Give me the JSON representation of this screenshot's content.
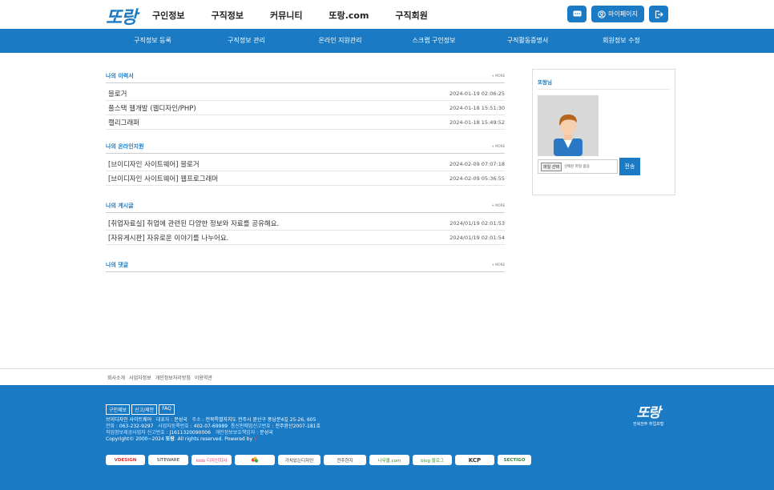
{
  "header": {
    "logo": "또랑",
    "nav": [
      "구인정보",
      "구직정보",
      "커뮤니티",
      "또랑.com",
      "구직회원"
    ],
    "mypage_label": "마이페이지"
  },
  "subnav": [
    "구직정보 등록",
    "구직정보 관리",
    "온라인 지원관리",
    "스크랩 구인정보",
    "구직활동증명서",
    "회원정보 수정"
  ],
  "sections": {
    "resume": {
      "title": "나의 이력서",
      "more": "+ MORE",
      "rows": [
        {
          "title": "블로거",
          "date": "2024-01-19 02:06:25"
        },
        {
          "title": "풀스택 웹개발 (웹디자인/PHP)",
          "date": "2024-01-18 15:51:30"
        },
        {
          "title": "캘리그래퍼",
          "date": "2024-01-18 15:49:52"
        }
      ]
    },
    "apply": {
      "title": "나의 온라인지원",
      "more": "+ MORE",
      "rows": [
        {
          "title": "[브이디자인 사이트웨어] 블로거",
          "date": "2024-02-09 07:07:18"
        },
        {
          "title": "[브이디자인 사이트웨어] 웹프로그래머",
          "date": "2024-02-09 05:36:55"
        }
      ]
    },
    "posts": {
      "title": "나의 게시글",
      "more": "+ MORE",
      "rows": [
        {
          "title": "[취업자료실] 취업에 관련된 다양한 정보와 자료를 공유해요.",
          "date": "2024/01/19 02:01:53"
        },
        {
          "title": "[자유게시판] 자유로운 이야기를 나누어요.",
          "date": "2024/01/19 02:01:54"
        }
      ]
    },
    "comments": {
      "title": "나의 댓글",
      "more": "+ MORE"
    }
  },
  "profile": {
    "name": "또랑님",
    "file_button": "파일 선택",
    "file_status": "선택된 파일 없음",
    "send_label": "전송"
  },
  "footer_links": [
    "회사소개",
    "사업자정보",
    "개인정보처리방침",
    "이용약관"
  ],
  "footer": {
    "buttons": [
      "구인제보",
      "신고/제안",
      "FAQ"
    ],
    "line1_company": "브이디자인 사이트웨어",
    "line1_rep_label": "대표자 : ",
    "line1_rep": "문성국",
    "line1_addr_label": "주소 : ",
    "line1_addr": "전북특별자치도 전주시 완산구 풍남문4길 25-26, 605",
    "line2_tel_label": "전화 : ",
    "line2_tel": "063-232-9297",
    "line2_biz_label": "사업자등록번호 : ",
    "line2_biz": "402-07-69989",
    "line2_mail_label": "통신판매업신고번호 : ",
    "line2_mail": "전주완산2007-181호",
    "line3_job_label": "직업정보제공사업자 신고번호 : ",
    "line3_job": "J1611320090006",
    "line3_priv_label": "개인정보보호책임자 : ",
    "line3_priv": "문성국",
    "line4_pre": "Copyright© 2000~2024 ",
    "line4_brand": "또랑",
    "line4_post": ". All rights reserved. Powered by ",
    "line4_v": "V",
    "logo_big": "또랑",
    "logo_small": "전북전주 취업포털",
    "badges": [
      "VDESIGN",
      "SITEWARE",
      "kido 디자인회사",
      "",
      "가치있는디자인",
      "전주한지",
      "나무몰.com",
      "blog 블로그",
      "KCP",
      "SECTIGO"
    ]
  }
}
